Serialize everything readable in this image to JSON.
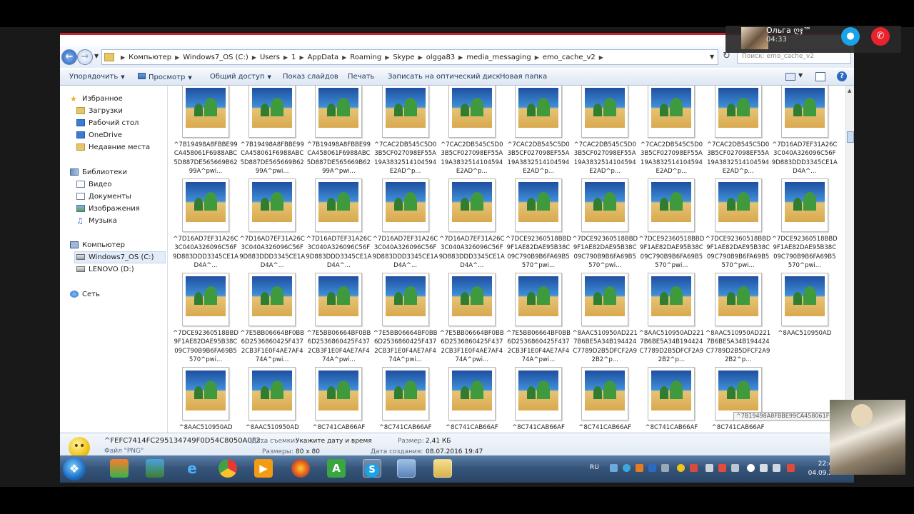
{
  "breadcrumbs": [
    "Компьютер",
    "Windows7_OS (C:)",
    "Users",
    "1",
    "AppData",
    "Roaming",
    "Skype",
    "olgga83",
    "media_messaging",
    "emo_cache_v2"
  ],
  "search_placeholder": "Поиск: emo_cache_v2",
  "toolbar": {
    "organize": "Упорядочить",
    "view": "Просмотр",
    "share": "Общий доступ",
    "slideshow": "Показ слайдов",
    "print": "Печать",
    "burn": "Записать на оптический диск",
    "new_folder": "Новая папка"
  },
  "sidebar": {
    "favorites": "Избранное",
    "downloads": "Загрузки",
    "desktop": "Рабочий стол",
    "onedrive": "OneDrive",
    "recent": "Недавние места",
    "libraries": "Библиотеки",
    "video": "Видео",
    "documents": "Документы",
    "images": "Изображения",
    "music": "Музыка",
    "computer": "Компьютер",
    "drive_c": "Windows7_OS (C:)",
    "drive_d": "LENOVO (D:)",
    "network": "Сеть"
  },
  "files": [
    "^7B19498A8FBBE99CA458061F6988ABC5D887DE565669B6299A^pwi...",
    "^7B19498A8FBBE99CA458061F6988ABC5D887DE565669B6299A^pwi...",
    "^7B19498A8FBBE99CA458061F6988ABC5D887DE565669B6299A^pwi...",
    "^7CAC2DB545C5D03B5CF027098EF55A19A3832514104594E2AD^p...",
    "^7CAC2DB545C5D03B5CF027098EF55A19A3832514104594E2AD^p...",
    "^7CAC2DB545C5D03B5CF027098EF55A19A3832514104594E2AD^p...",
    "^7CAC2DB545C5D03B5CF027098EF55A19A3832514104594E2AD^p...",
    "^7CAC2DB545C5D03B5CF027098EF55A19A3832514104594E2AD^p...",
    "^7CAC2DB545C5D03B5CF027098EF55A19A3832514104594E2AD^p...",
    "^7D16AD7EF31A26C3C040A326096C56F9D883DDD3345CE1AD4A^...",
    "^7D16AD7EF31A26C3C040A326096C56F9D883DDD3345CE1AD4A^...",
    "^7D16AD7EF31A26C3C040A326096C56F9D883DDD3345CE1AD4A^...",
    "^7D16AD7EF31A26C3C040A326096C56F9D883DDD3345CE1AD4A^...",
    "^7D16AD7EF31A26C3C040A326096C56F9D883DDD3345CE1AD4A^...",
    "^7D16AD7EF31A26C3C040A326096C56F9D883DDD3345CE1AD4A^...",
    "^7DCE92360518BBD9F1AE82DAE95B38C09C790B9B6FA69B5570^pwi...",
    "^7DCE92360518BBD9F1AE82DAE95B38C09C790B9B6FA69B5570^pwi...",
    "^7DCE92360518BBD9F1AE82DAE95B38C09C790B9B6FA69B5570^pwi...",
    "^7DCE92360518BBD9F1AE82DAE95B38C09C790B9B6FA69B5570^pwi...",
    "^7DCE92360518BBD9F1AE82DAE95B38C09C790B9B6FA69B5570^pwi...",
    "^7DCE92360518BBD9F1AE82DAE95B38C09C790B9B6FA69B5570^pwi...",
    "^7E5BB06664BF0BB6D2536860425F4372CB3F1E0F4AE7AF474A^pwi...",
    "^7E5BB06664BF0BB6D2536860425F4372CB3F1E0F4AE7AF474A^pwi...",
    "^7E5BB06664BF0BB6D2536860425F4372CB3F1E0F4AE7AF474A^pwi...",
    "^7E5BB06664BF0BB6D2536860425F4372CB3F1E0F4AE7AF474A^pwi...",
    "^7E5BB06664BF0BB6D2536860425F4372CB3F1E0F4AE7AF474A^pwi...",
    "^8AAC510950AD2217B6BE5A34B194424C7789D2B5DFCF2A92B2^p...",
    "^8AAC510950AD2217B6BE5A34B194424C7789D2B5DFCF2A92B2^p...",
    "^8AAC510950AD2217B6BE5A34B194424C7789D2B5DFCF2A92B2^p...",
    "^8AAC510950AD",
    "^8AAC510950AD",
    "^8AAC510950AD",
    "^8C741CAB66AF",
    "^8C741CAB66AF",
    "^8C741CAB66AF",
    "^8C741CAB66AF",
    "^8C741CAB66AF",
    "^8C741CAB66AF",
    "^8C741CAB66AF"
  ],
  "tooltip": "^7B19498A8FBBE99CA458061F6988ABC5",
  "details": {
    "filename": "^FEFC7414FC295134749F0D54C8050A0F2...",
    "filetype": "Файл \"PNG\"",
    "date_taken_label": "Дата съемки:",
    "date_taken_value": "Укажите дату и время",
    "dimensions_label": "Размеры:",
    "dimensions_value": "80 x 80",
    "size_label": "Размер:",
    "size_value": "2,41 КБ",
    "created_label": "Дата создания:",
    "created_value": "08.07.2016 19:47"
  },
  "skype_call": {
    "name": "Ольга ღჯ™",
    "duration": "04:33"
  },
  "taskbar": {
    "lang": "RU",
    "time": "22:4",
    "date": "04.09.2"
  }
}
